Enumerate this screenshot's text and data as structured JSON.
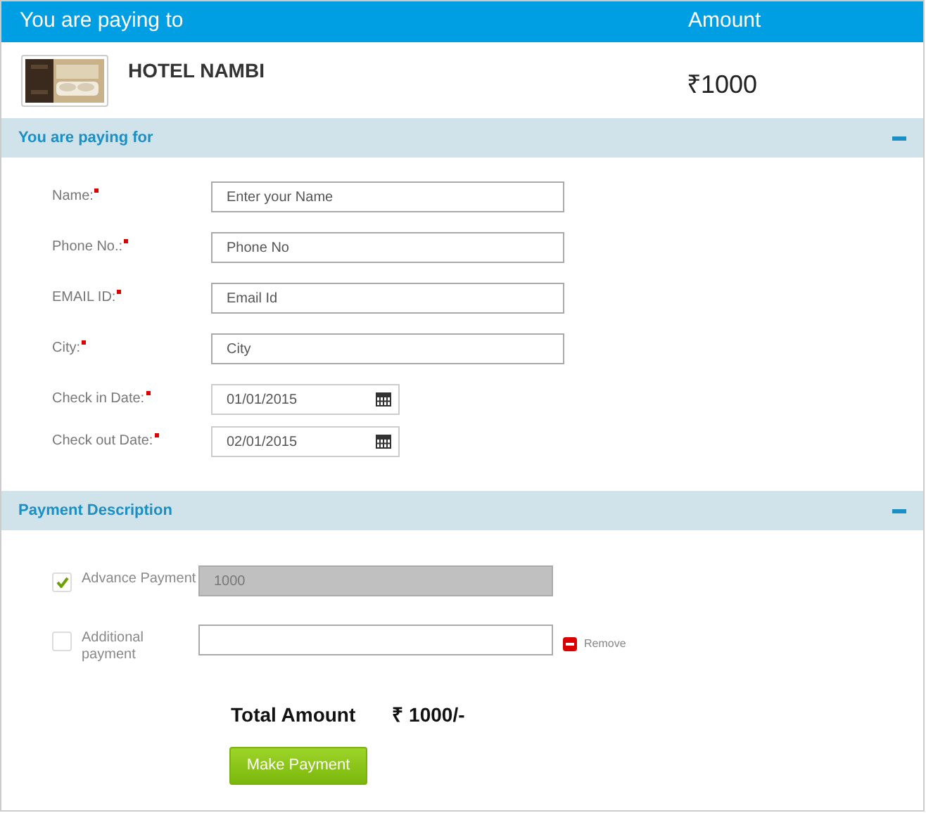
{
  "header": {
    "payee_label": "You are paying to",
    "amount_label": "Amount"
  },
  "hotel": {
    "name": "HOTEL NAMBI",
    "amount": "₹1000"
  },
  "sections": [
    {
      "title": "You are paying for",
      "expanded": true
    },
    {
      "title": "Payment Description",
      "expanded": true
    }
  ],
  "fields": [
    {
      "kind": "text",
      "label": "Name:",
      "required": true,
      "placeholder": "Enter your Name"
    },
    {
      "kind": "text",
      "label": "Phone No.:",
      "required": true,
      "placeholder": "Phone No"
    },
    {
      "kind": "text",
      "label": "EMAIL ID:",
      "required": true,
      "placeholder": "Email Id"
    },
    {
      "kind": "text",
      "label": "City:",
      "required": true,
      "placeholder": "City"
    },
    {
      "kind": "date",
      "label": "Check in Date:",
      "required": true,
      "value": "01/01/2015"
    },
    {
      "kind": "date",
      "label": "Check out Date:",
      "required": true,
      "value": "02/01/2015"
    }
  ],
  "payments": [
    {
      "label": "Advance Payment",
      "checked": true,
      "disabled": true,
      "value": "1000"
    },
    {
      "label": "Additional payment",
      "checked": false,
      "disabled": false,
      "remove_label": "Remove"
    }
  ],
  "total": {
    "label": "Total Amount",
    "value": "₹ 1000/-"
  },
  "submit": "Make Payment"
}
